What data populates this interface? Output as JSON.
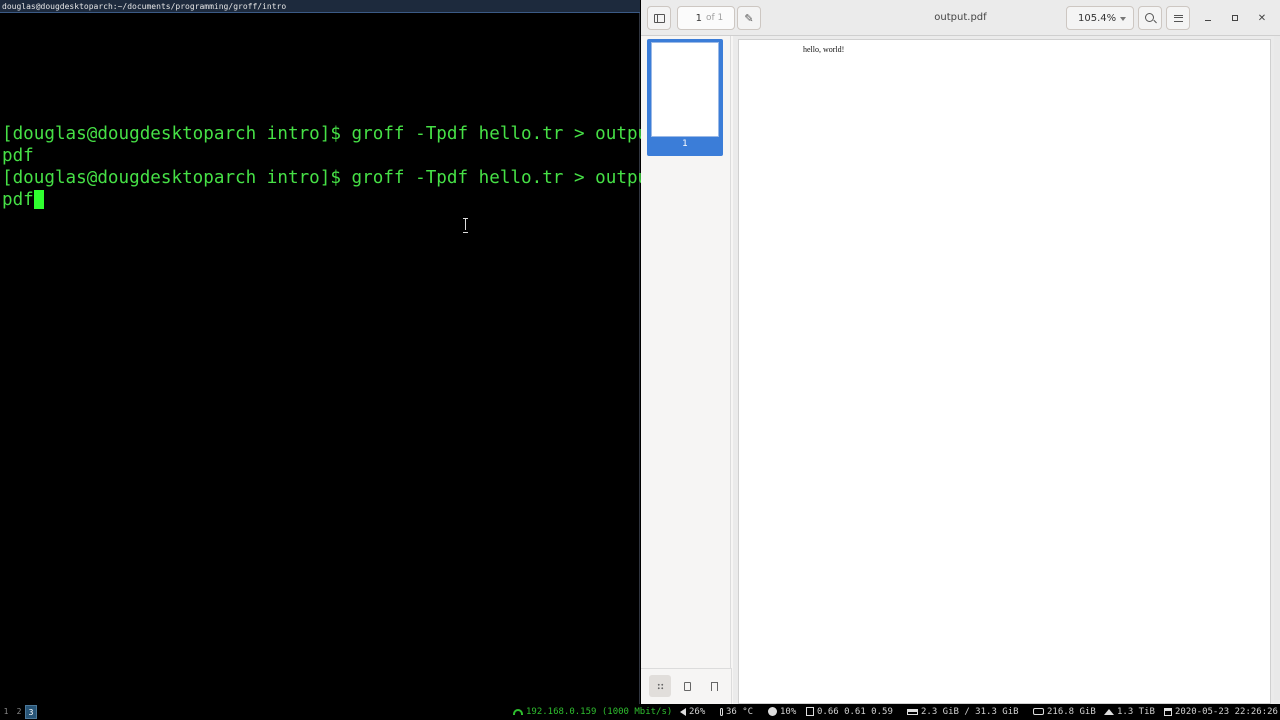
{
  "terminal": {
    "title": "douglas@dougdesktoparch:~/documents/programming/groff/intro",
    "lines": [
      "[douglas@dougdesktoparch intro]$ groff -Tpdf hello.tr > output.",
      "pdf",
      "[douglas@dougdesktoparch intro]$ groff -Tpdf hello.tr > output.",
      "pdf"
    ]
  },
  "viewer": {
    "page_current": "1",
    "page_of": "of 1",
    "title": "output.pdf",
    "zoom": "105.4%",
    "thumb_label": "1",
    "page_text": "hello, world!"
  },
  "statusbar": {
    "workspaces": [
      "1",
      "2",
      "3"
    ],
    "active_workspace": "3",
    "network": "192.168.0.159 (1000 Mbit/s)",
    "volume": "26%",
    "temperature": "36 °C",
    "cpu": "10%",
    "load": "0.66 0.61 0.59",
    "memory": "2.3 GiB / 31.3 GiB",
    "disk_root": "216.8 GiB",
    "disk_home": "1.3 TiB",
    "datetime": "2020-05-23 22:26:26"
  },
  "colors": {
    "terminal_text": "#46e046",
    "cursor": "#2fff2f",
    "selection": "#3b7dd8",
    "active_workspace": "#285577",
    "network_text": "#2fbf2f"
  },
  "icons": {
    "sidebar_toggle": "sidebar-icon",
    "annotate": "pencil-icon",
    "search": "search-icon",
    "menu": "hamburger-icon",
    "thumbnails": "grid-icon",
    "outline": "document-icon",
    "bookmarks": "bookmark-icon"
  }
}
